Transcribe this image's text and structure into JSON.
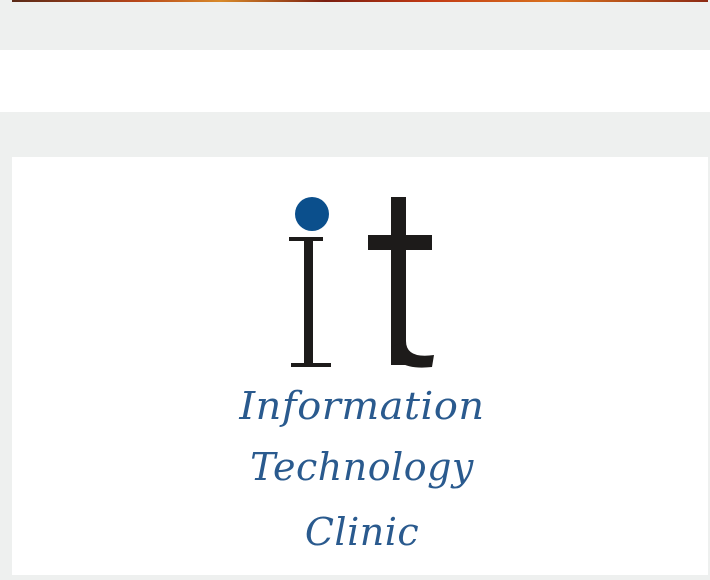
{
  "logo": {
    "mark": "it",
    "line1": "Information",
    "line2": "Technology",
    "line3": "Clinic"
  },
  "colors": {
    "page_background": "#eef0ef",
    "card_background": "#ffffff",
    "logo_dot": "#0b4f8c",
    "logo_letters": "#1d1b1a",
    "logo_wordmark": "#2a5a8e"
  }
}
